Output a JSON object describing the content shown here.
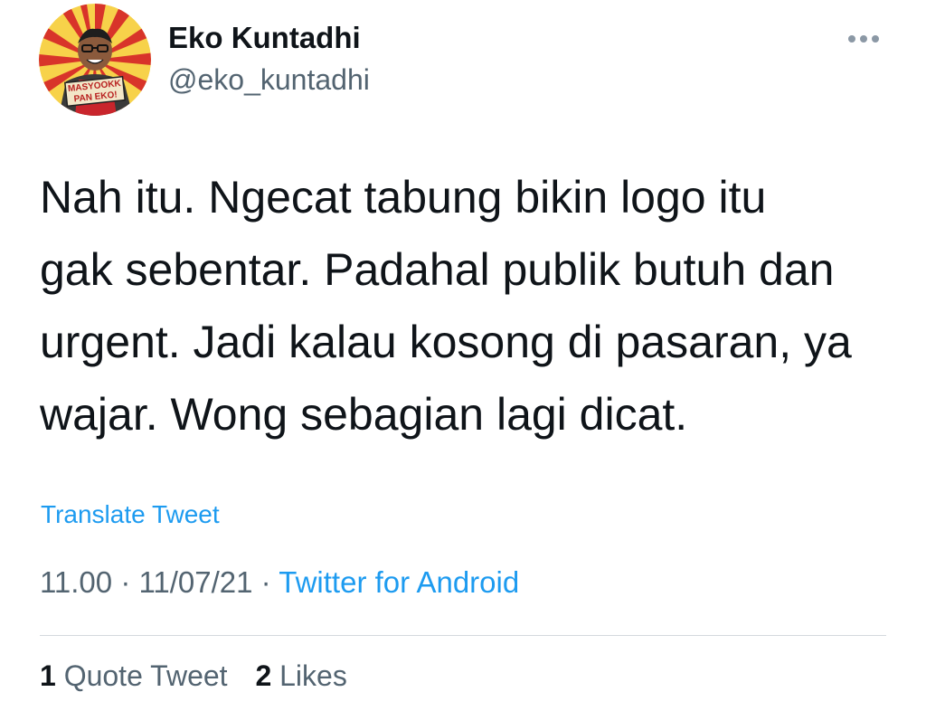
{
  "author": {
    "display_name": "Eko Kuntadhi",
    "handle": "@eko_kuntadhi",
    "avatar_text_line1": "MASYOOKK",
    "avatar_text_line2": "PAN EKO!"
  },
  "more_icon": "more-horizontal-icon",
  "tweet": {
    "text": "Nah itu. Ngecat tabung bikin logo itu\ngak sebentar. Padahal publik butuh dan\nurgent. Jadi kalau kosong di pasaran, ya\nwajar. Wong sebagian lagi dicat.",
    "translate_label": "Translate Tweet",
    "time": "11.00",
    "date": "11/07/21",
    "separator": "·",
    "source": "Twitter for Android"
  },
  "stats": {
    "quote_count": "1",
    "quote_label": "Quote Tweet",
    "like_count": "2",
    "like_label": "Likes"
  },
  "colors": {
    "link": "#1d9bf0",
    "secondary_text": "#536471",
    "primary_text": "#0f1419",
    "divider": "#d4d9dd"
  }
}
